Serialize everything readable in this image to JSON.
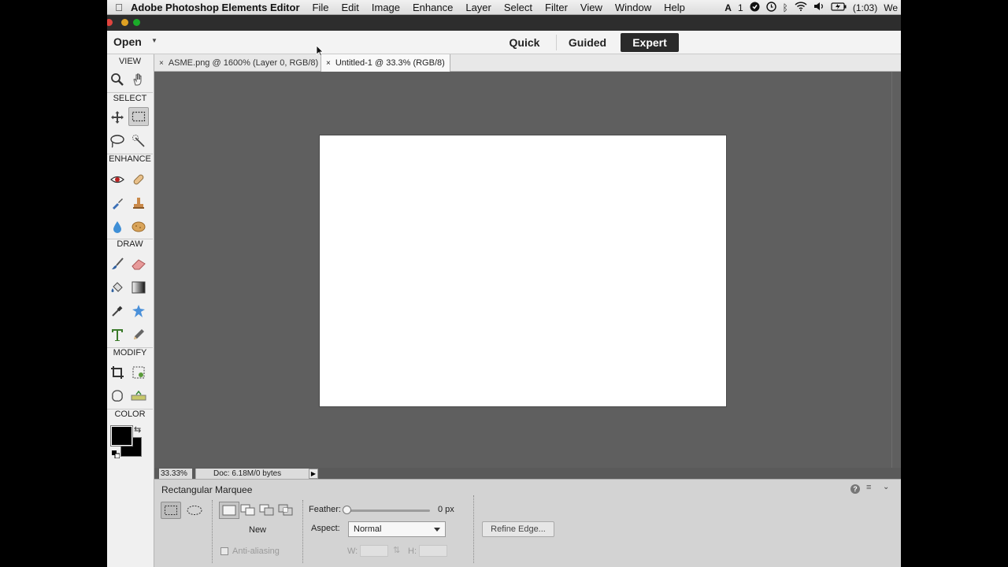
{
  "menubar": {
    "app_name": "Adobe Photoshop Elements Editor",
    "items": [
      "File",
      "Edit",
      "Image",
      "Enhance",
      "Layer",
      "Select",
      "Filter",
      "View",
      "Window",
      "Help"
    ],
    "status": {
      "adobe_count": "1",
      "battery": "(1:03)",
      "day": "We"
    }
  },
  "topbar": {
    "open_label": "Open",
    "modes": [
      "Quick",
      "Guided",
      "Expert"
    ],
    "active_mode": "Expert"
  },
  "toolbar": {
    "sections": {
      "view": "VIEW",
      "select": "SELECT",
      "enhance": "ENHANCE",
      "draw": "DRAW",
      "modify": "MODIFY",
      "color": "COLOR"
    },
    "colors": {
      "foreground": "#000000",
      "background": "#000000"
    }
  },
  "tabs": [
    {
      "label": "ASME.png @ 1600% (Layer 0, RGB/8)",
      "close": "×"
    },
    {
      "label": "Untitled-1 @ 33.3% (RGB/8)",
      "close": "×"
    }
  ],
  "statusbar": {
    "zoom": "33.33%",
    "doc_info": "Doc: 6.18M/0 bytes"
  },
  "options": {
    "tool_name": "Rectangular Marquee",
    "mode_label": "New",
    "antialias_label": "Anti-aliasing",
    "feather_label": "Feather:",
    "feather_value": "0 px",
    "aspect_label": "Aspect:",
    "aspect_value": "Normal",
    "w_label": "W:",
    "h_label": "H:",
    "refine_label": "Refine Edge..."
  }
}
